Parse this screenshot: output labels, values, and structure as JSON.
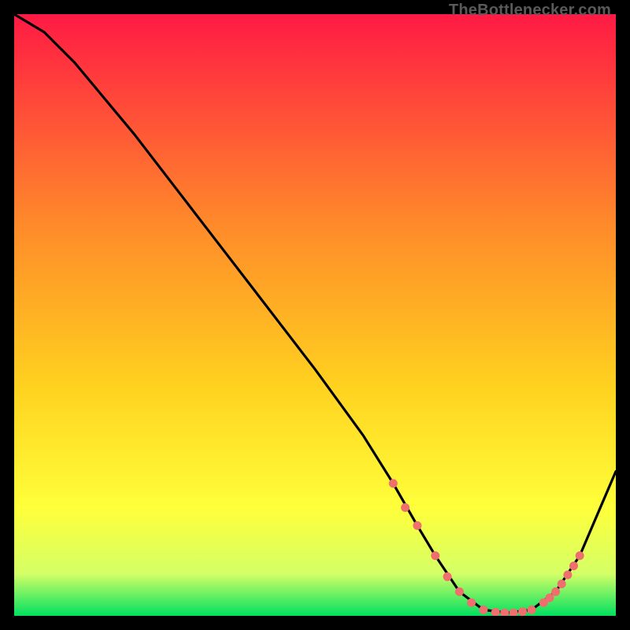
{
  "watermark": "TheBottlenecker.com",
  "colors": {
    "gradient_top": "#ff1a44",
    "gradient_mid1": "#ff6a2e",
    "gradient_mid2": "#ffd21f",
    "gradient_mid3": "#ffff3a",
    "gradient_bottom": "#00e060",
    "curve": "#000000",
    "marker": "#ef6e6e"
  },
  "chart_data": {
    "type": "line",
    "title": "",
    "xlabel": "",
    "ylabel": "",
    "xlim": [
      0,
      100
    ],
    "ylim": [
      0,
      100
    ],
    "series": [
      {
        "name": "curve",
        "x": [
          0,
          5,
          10,
          20,
          30,
          40,
          50,
          58,
          63,
          67,
          70,
          74,
          78,
          82,
          86,
          90,
          94,
          100
        ],
        "y": [
          100,
          97,
          92,
          80,
          67,
          54,
          41,
          30,
          22,
          15,
          10,
          4,
          1,
          0.5,
          1,
          4,
          10,
          24
        ]
      }
    ],
    "markers": {
      "name": "dotted-segment",
      "x": [
        63,
        65,
        67,
        70,
        72,
        74,
        76,
        78,
        80,
        81.5,
        83,
        84.5,
        86,
        88,
        89,
        90,
        91,
        92,
        93,
        94
      ],
      "y": [
        22,
        18,
        15,
        10,
        6.5,
        4,
        2.2,
        1,
        0.6,
        0.5,
        0.5,
        0.7,
        1,
        2.2,
        3,
        4,
        5.3,
        6.8,
        8.3,
        10
      ]
    }
  }
}
